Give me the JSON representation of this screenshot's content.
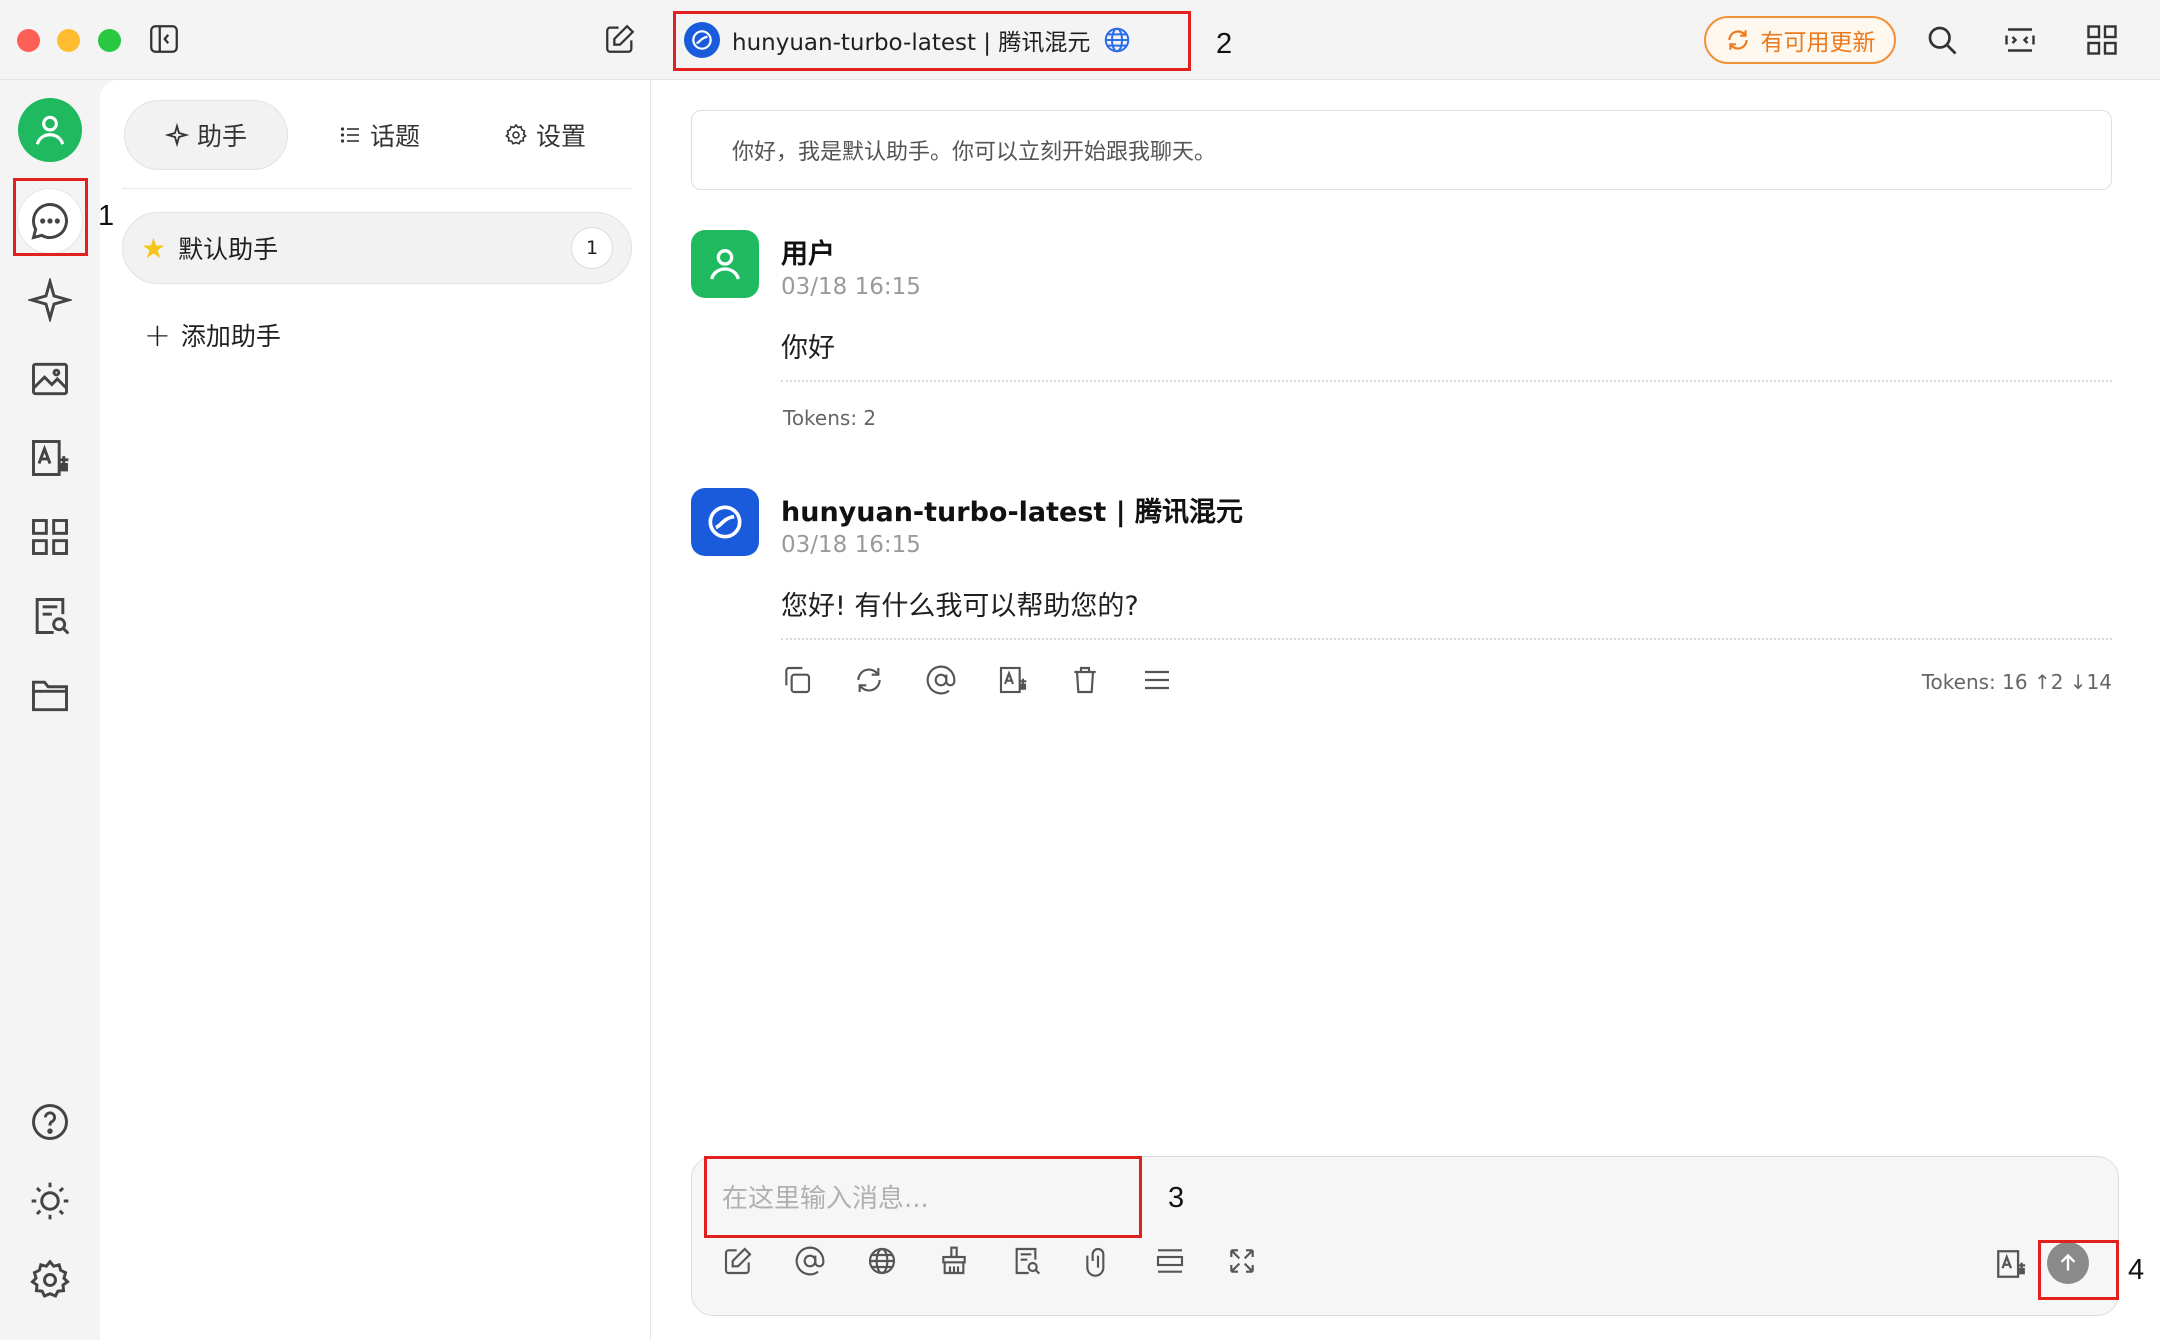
{
  "header": {
    "model_name": "hunyuan-turbo-latest | 腾讯混元",
    "update_label": "有可用更新"
  },
  "tabs": [
    {
      "label": "助手",
      "icon": "sparkle-icon"
    },
    {
      "label": "话题",
      "icon": "list-icon"
    },
    {
      "label": "设置",
      "icon": "gear-icon"
    }
  ],
  "assistants": [
    {
      "label": "默认助手",
      "icon": "star-icon",
      "count": "1"
    }
  ],
  "add_assistant_label": "添加助手",
  "system_message": "你好，我是默认助手。你可以立刻开始跟我聊天。",
  "messages": [
    {
      "sender": "用户",
      "time": "03/18 16:15",
      "text": "你好",
      "tokens": "Tokens: 2"
    },
    {
      "sender": "hunyuan-turbo-latest | 腾讯混元",
      "time": "03/18 16:15",
      "text": "您好! 有什么我可以帮助您的?",
      "tokens": "Tokens: 16 ↑2 ↓14"
    }
  ],
  "input": {
    "placeholder": "在这里输入消息..."
  },
  "annotations": [
    "1",
    "2",
    "3",
    "4"
  ],
  "colors": {
    "avatar_green": "#1fba5f",
    "model_blue": "#1a5bdb",
    "update_orange": "#ec7a1c",
    "highlight_red": "#e32020"
  }
}
